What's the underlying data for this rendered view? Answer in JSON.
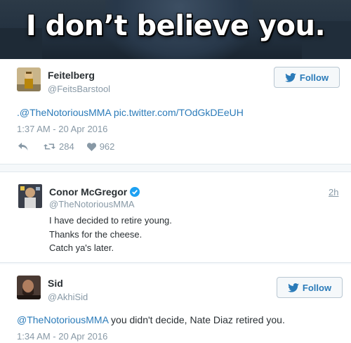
{
  "banner": {
    "caption": "I don’t believe you."
  },
  "tweet1": {
    "name": "Feitelberg",
    "handle": "@FeitsBarstool",
    "follow_label": "Follow",
    "text_mention": ".@TheNotoriousMMA",
    "text_link": " pic.twitter.com/TOdGkDEeUH",
    "timestamp": "1:37 AM - 20 Apr 2016",
    "retweets": "284",
    "likes": "962"
  },
  "tweet2": {
    "name": "Conor McGregor",
    "handle": "@TheNotoriousMMA",
    "age": "2h",
    "lines": [
      "I have decided to retire young.",
      "Thanks for the cheese.",
      "Catch ya's later."
    ]
  },
  "tweet3": {
    "name": "Sid",
    "handle": "@AkhiSid",
    "follow_label": "Follow",
    "text_mention": "@TheNotoriousMMA",
    "text_rest": " you didn't decide, Nate Diaz retired you.",
    "timestamp": "1:34 AM - 20 Apr 2016"
  },
  "colors": {
    "link": "#2b7bb9",
    "muted": "#8899a6",
    "verified": "#1da1f2"
  },
  "icons": [
    "twitter-bird-icon",
    "reply-icon",
    "retweet-icon",
    "heart-icon",
    "verified-badge-icon"
  ]
}
